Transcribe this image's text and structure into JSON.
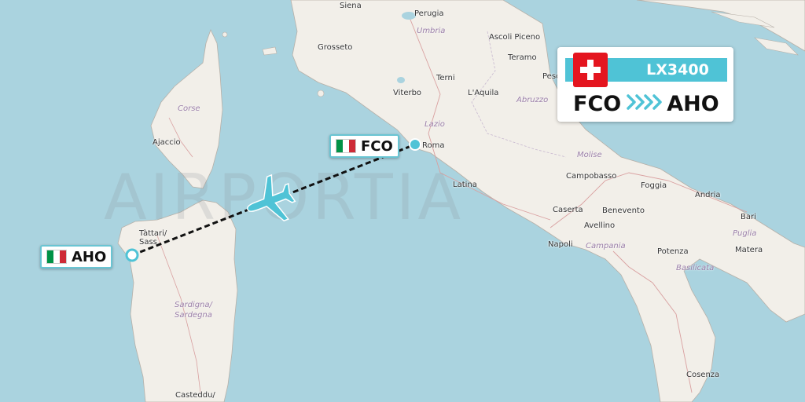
{
  "watermark": "AIRPORTIA",
  "flight": {
    "number": "LX3400",
    "airline_flag": "Switzerland",
    "origin": "FCO",
    "destination": "AHO"
  },
  "origin_marker": {
    "code": "FCO",
    "flag": "Italy"
  },
  "destination_marker": {
    "code": "AHO",
    "flag": "Italy"
  },
  "place_labels": {
    "siena": "Siena",
    "perugia": "Perugia",
    "umbria": "Umbria",
    "ascoli": "Ascoli Piceno",
    "grosseto": "Grosseto",
    "teramo": "Teramo",
    "pescara": "Pesc",
    "terni": "Terni",
    "viterbo": "Viterbo",
    "laquila": "L'Aquila",
    "abruzzo": "Abruzzo",
    "corse": "Corse",
    "ajaccio": "Ajaccio",
    "lazio": "Lazio",
    "roma": "Roma",
    "molise": "Molise",
    "campobasso": "Campobasso",
    "foggia": "Foggia",
    "latina": "Latina",
    "andria": "Andria",
    "bari": "Bari",
    "caserta": "Caserta",
    "benevento": "Benevento",
    "puglia": "Puglia",
    "tattari": "Tàttari/",
    "sassari": "Sass",
    "avellino": "Avellino",
    "napoli": "Napoli",
    "campania": "Campania",
    "potenza": "Potenza",
    "matera": "Matera",
    "basilicata": "Basilicata",
    "sardegna1": "Sardigna/",
    "sardegna2": "Sardegna",
    "casteddu": "Casteddu/",
    "cosenza": "Cosenza"
  },
  "colors": {
    "sea": "#aad3df",
    "land": "#f2efe9",
    "route_line": "#111111",
    "marker": "#4fc3d6",
    "accent": "#4fc3d6",
    "swiss_red": "#e4151f",
    "italy_green": "#009246",
    "italy_red": "#ce2b37"
  }
}
